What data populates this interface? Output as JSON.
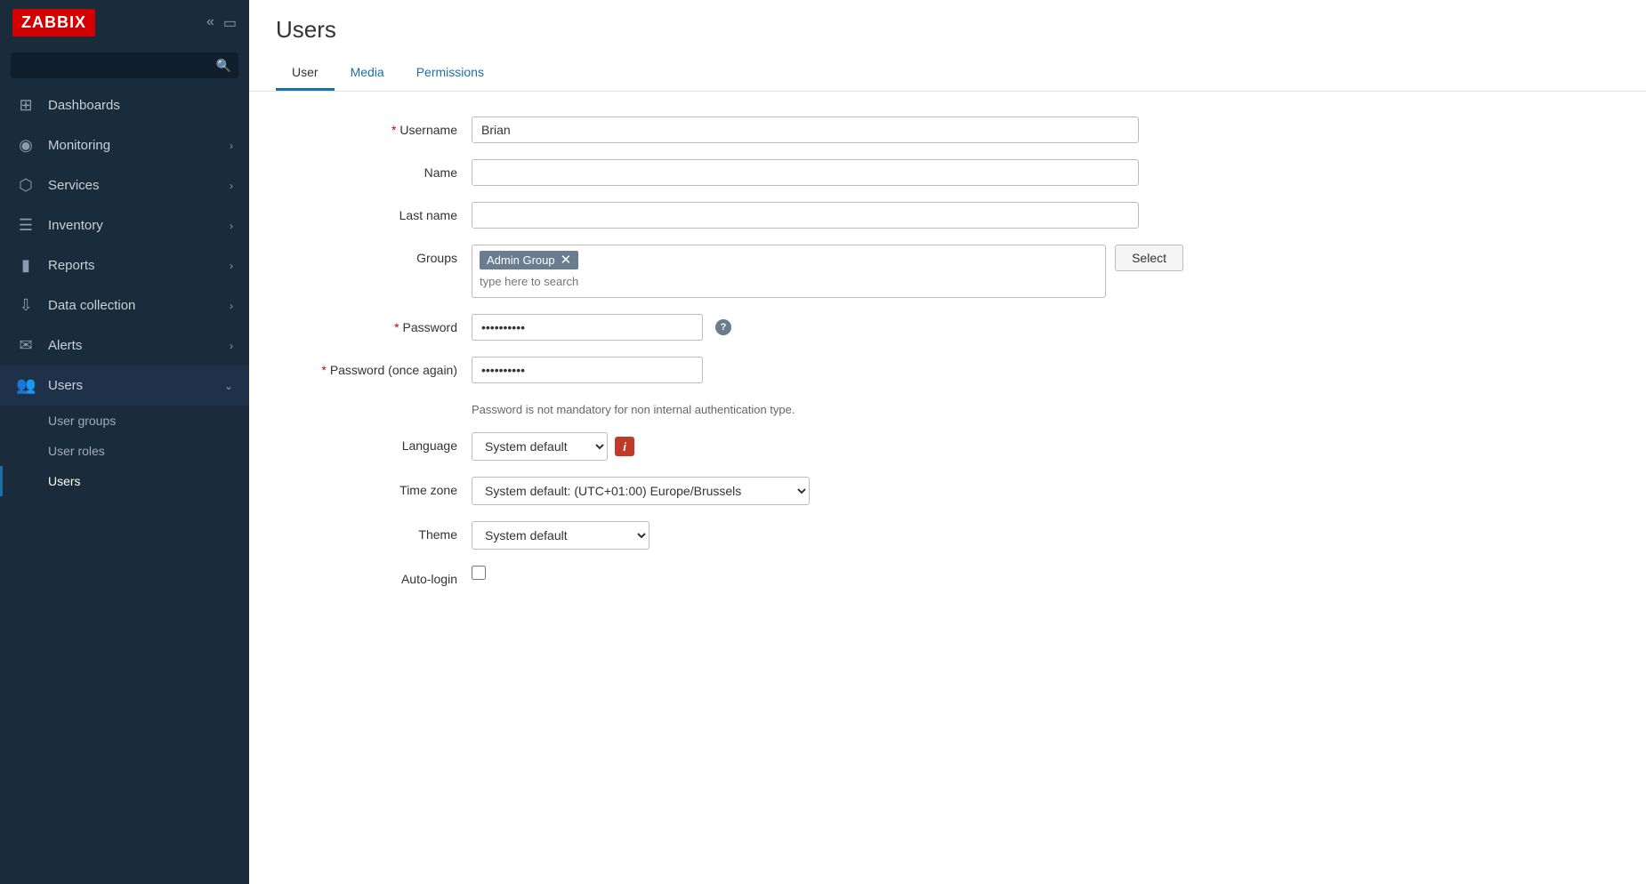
{
  "app": {
    "logo": "ZABBIX",
    "page_title": "Users"
  },
  "search": {
    "placeholder": ""
  },
  "sidebar": {
    "items": [
      {
        "id": "dashboards",
        "label": "Dashboards",
        "icon": "⊞",
        "has_arrow": false
      },
      {
        "id": "monitoring",
        "label": "Monitoring",
        "icon": "◉",
        "has_arrow": true
      },
      {
        "id": "services",
        "label": "Services",
        "icon": "⬡",
        "has_arrow": true
      },
      {
        "id": "inventory",
        "label": "Inventory",
        "icon": "≡",
        "has_arrow": true
      },
      {
        "id": "reports",
        "label": "Reports",
        "icon": "⬛",
        "has_arrow": true
      },
      {
        "id": "data-collection",
        "label": "Data collection",
        "icon": "⬇",
        "has_arrow": true
      },
      {
        "id": "alerts",
        "label": "Alerts",
        "icon": "✉",
        "has_arrow": true
      },
      {
        "id": "users",
        "label": "Users",
        "icon": "👥",
        "has_arrow": true,
        "active": true
      }
    ],
    "subitems": [
      {
        "id": "user-groups",
        "label": "User groups"
      },
      {
        "id": "user-roles",
        "label": "User roles"
      },
      {
        "id": "users",
        "label": "Users",
        "active": true
      }
    ]
  },
  "tabs": [
    {
      "id": "user",
      "label": "User",
      "active": true
    },
    {
      "id": "media",
      "label": "Media",
      "active": false
    },
    {
      "id": "permissions",
      "label": "Permissions",
      "active": false
    }
  ],
  "form": {
    "username_label": "Username",
    "username_value": "Brian",
    "name_label": "Name",
    "name_value": "",
    "lastname_label": "Last name",
    "lastname_value": "",
    "groups_label": "Groups",
    "group_tag": "Admin Group",
    "groups_placeholder": "type here to search",
    "select_button": "Select",
    "password_label": "Password",
    "password_value": "••••••••••",
    "password_once_label": "Password (once again)",
    "password_once_value": "••••••••••",
    "password_info": "Password is not mandatory for non internal authentication type.",
    "language_label": "Language",
    "language_value": "System default",
    "language_options": [
      "System default"
    ],
    "info_badge": "i",
    "timezone_label": "Time zone",
    "timezone_value": "System default: (UTC+01:00) Europe/Brussels",
    "timezone_options": [
      "System default: (UTC+01:00) Europe/Brussels"
    ],
    "theme_label": "Theme",
    "theme_value": "System default",
    "theme_options": [
      "System default"
    ],
    "autologin_label": "Auto-login"
  }
}
